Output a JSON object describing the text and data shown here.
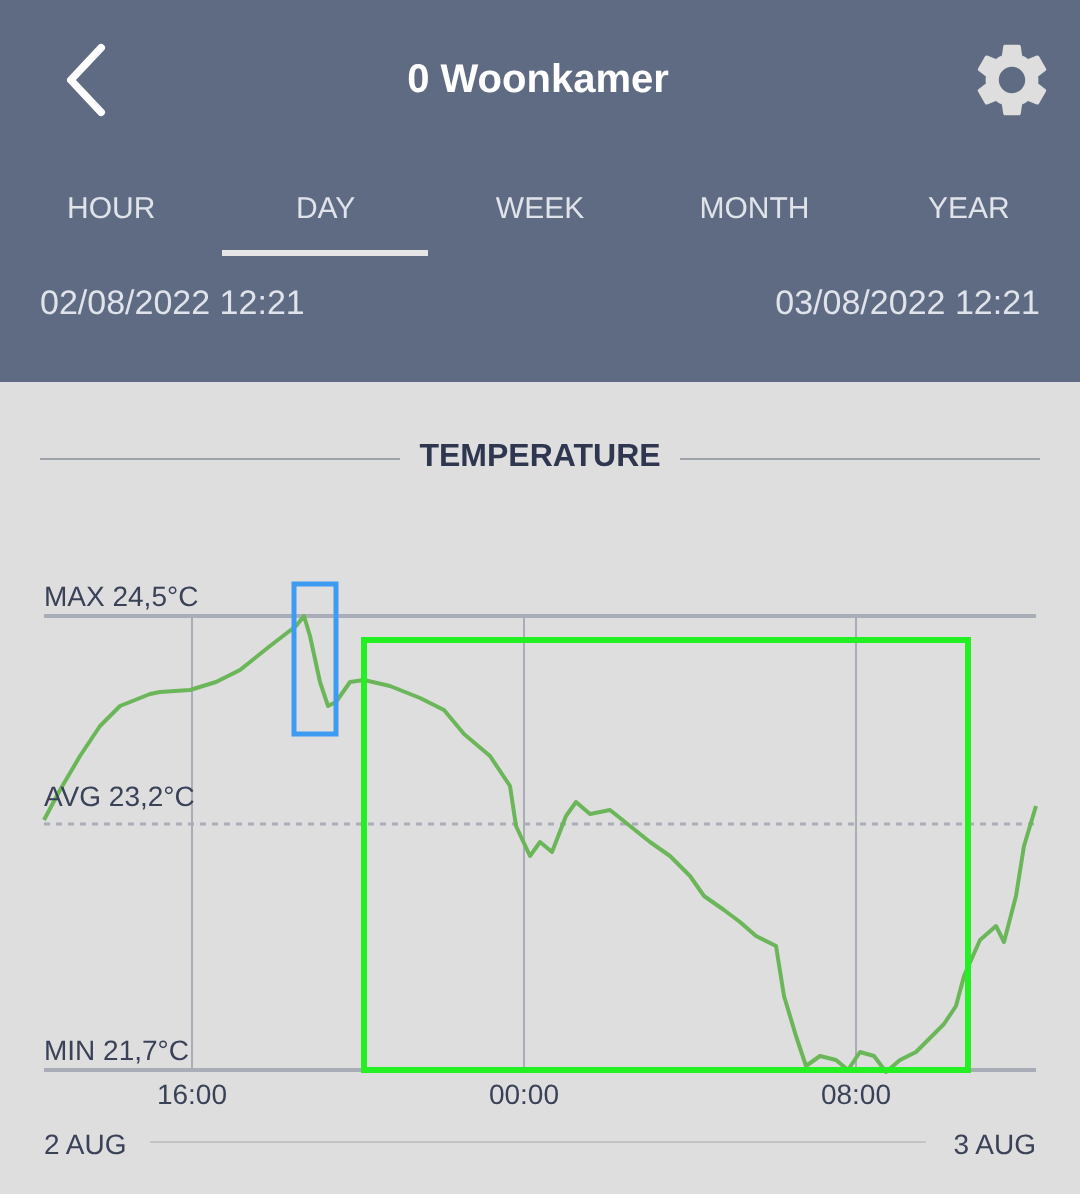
{
  "header": {
    "title": "0 Woonkamer"
  },
  "tabs": [
    {
      "label": "HOUR",
      "selected": false
    },
    {
      "label": "DAY",
      "selected": true
    },
    {
      "label": "WEEK",
      "selected": false
    },
    {
      "label": "MONTH",
      "selected": false
    },
    {
      "label": "YEAR",
      "selected": false
    }
  ],
  "range": {
    "start": "02/08/2022 12:21",
    "end": "03/08/2022 12:21"
  },
  "section_title": "TEMPERATURE",
  "chart": {
    "y_labels": [
      "MAX 24,5°C",
      "AVG 23,2°C",
      "MIN 21,7°C"
    ],
    "x_labels": [
      "16:00",
      "00:00",
      "08:00"
    ],
    "date_start": "2 AUG",
    "date_end": "3 AUG"
  }
}
